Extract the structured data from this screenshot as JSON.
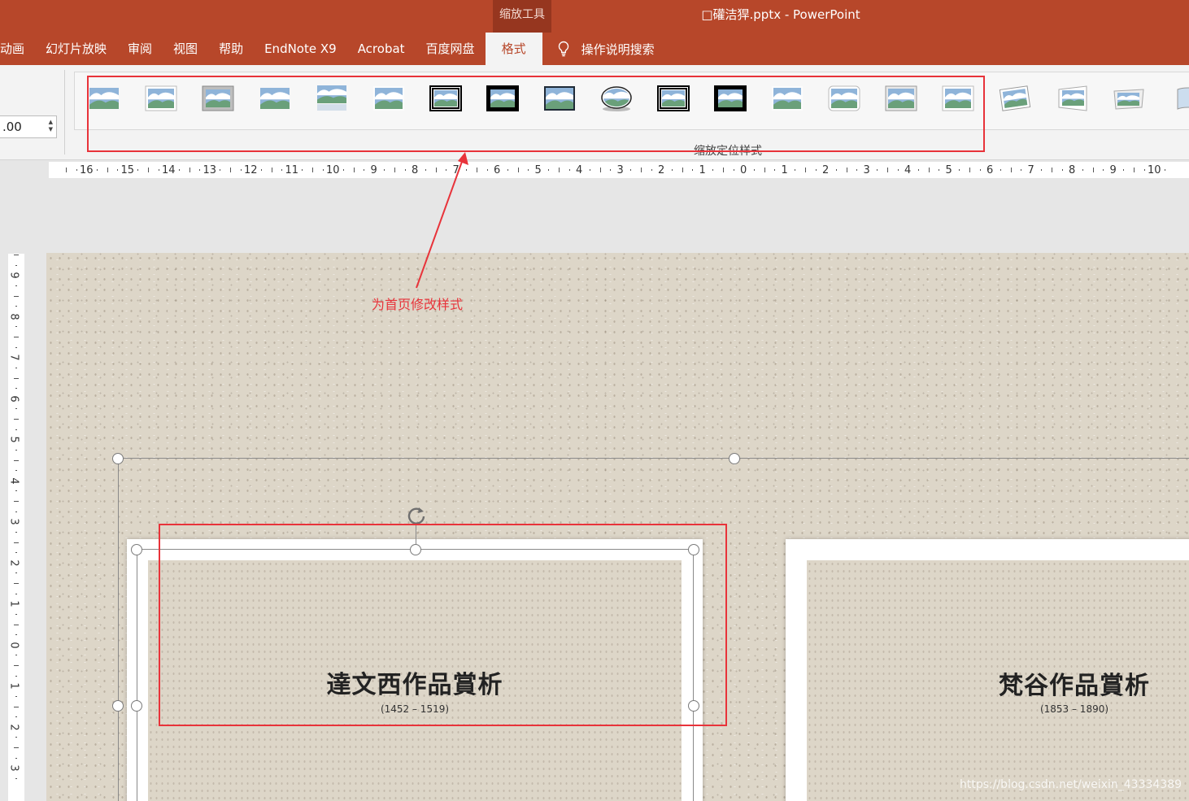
{
  "titlebar": {
    "context_group": "缩放工具",
    "doc_title": "□礶洁猂.pptx  -  PowerPoint"
  },
  "tabs": [
    {
      "label": "动画",
      "active": false
    },
    {
      "label": "幻灯片放映",
      "active": false
    },
    {
      "label": "审阅",
      "active": false
    },
    {
      "label": "视图",
      "active": false
    },
    {
      "label": "帮助",
      "active": false
    },
    {
      "label": "EndNote X9",
      "active": false
    },
    {
      "label": "Acrobat",
      "active": false
    },
    {
      "label": "百度网盘",
      "active": false
    },
    {
      "label": "格式",
      "active": true
    }
  ],
  "tell_me": {
    "icon": "lightbulb-icon",
    "label": "操作说明搜索"
  },
  "ribbon": {
    "size_value": ".00",
    "group_label": "缩放定位样式",
    "zoom_styles": [
      {
        "name": "style-1",
        "frame": "plain"
      },
      {
        "name": "style-2",
        "frame": "white-border"
      },
      {
        "name": "style-3",
        "frame": "gray-matte"
      },
      {
        "name": "style-4",
        "frame": "plain"
      },
      {
        "name": "style-5",
        "frame": "reflection"
      },
      {
        "name": "style-6",
        "frame": "soft-edge"
      },
      {
        "name": "style-7",
        "frame": "double-black"
      },
      {
        "name": "style-8",
        "frame": "thick-black"
      },
      {
        "name": "style-9",
        "frame": "thin-dark"
      },
      {
        "name": "style-10",
        "frame": "oval"
      },
      {
        "name": "style-11",
        "frame": "double-black"
      },
      {
        "name": "style-12",
        "frame": "thick-black"
      },
      {
        "name": "style-13",
        "frame": "soft-edge"
      },
      {
        "name": "style-14",
        "frame": "rounded-white"
      },
      {
        "name": "style-15",
        "frame": "bevel"
      },
      {
        "name": "style-16",
        "frame": "white-border"
      },
      {
        "name": "style-17",
        "frame": "rotated"
      },
      {
        "name": "style-18",
        "frame": "perspective-left"
      },
      {
        "name": "style-19",
        "frame": "perspective-flat"
      },
      {
        "name": "style-20",
        "frame": "curved"
      }
    ]
  },
  "ruler": {
    "horizontal": [
      "16",
      "15",
      "14",
      "13",
      "12",
      "11",
      "10",
      "9",
      "8",
      "7",
      "6",
      "5",
      "4",
      "3",
      "2",
      "1",
      "0",
      "1",
      "2",
      "3",
      "4",
      "5",
      "6",
      "7",
      "8",
      "9",
      "10"
    ],
    "vertical": [
      "9",
      "8",
      "7",
      "6",
      "5",
      "4",
      "3",
      "2",
      "1",
      "0",
      "1",
      "2",
      "3"
    ]
  },
  "slide": {
    "cards": [
      {
        "title": "達文西作品賞析",
        "subtitle": "(1452 – 1519)",
        "selected": true
      },
      {
        "title": "梵谷作品賞析",
        "subtitle": "(1853 – 1890)",
        "selected": false
      }
    ]
  },
  "annotation": {
    "text": "为首页修改样式",
    "color": "#e8333a"
  },
  "watermark": "https://blog.csdn.net/weixin_43334389",
  "colors": {
    "accent": "#b7472a",
    "context_dark": "#96361f",
    "annotation": "#e8333a"
  }
}
